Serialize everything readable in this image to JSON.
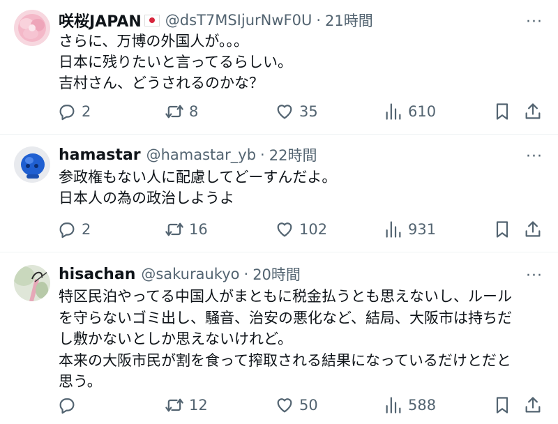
{
  "posts": [
    {
      "name": "咲桜JAPAN",
      "handle": "@dsT7MSIjurNwF0U",
      "separator": "·",
      "time": "21時間",
      "lines": [
        "さらに、万博の外国人が。。。",
        "日本に残りたいと言ってるらしい。",
        "吉村さん、どうされるのかな？"
      ],
      "replies": "2",
      "reposts": "8",
      "likes": "35",
      "views": "610",
      "avatar_icon": "pink-flower-avatar"
    },
    {
      "name": "hamastar",
      "handle": "@hamastar_yb",
      "separator": "·",
      "time": "22時間",
      "lines": [
        "参政権もない人に配慮してどーすんだよ。",
        "日本人の為の政治しようよ"
      ],
      "replies": "2",
      "reposts": "16",
      "likes": "102",
      "views": "931",
      "avatar_icon": "blue-character-avatar"
    },
    {
      "name": "hisachan",
      "handle": "@sakuraukyo",
      "separator": "·",
      "time": "20時間",
      "lines": [
        "特区民泊やってる中国人がまともに税金払うとも思えないし、ルール",
        "を守らないゴミ出し、騒音、治安の悪化など、結局、大阪市は持ちだ",
        "し敷かないとしか思えないけれど。",
        "本来の大阪市民が割を食って搾取される結果になっているだけとだと",
        "思う。"
      ],
      "replies": "",
      "reposts": "12",
      "likes": "50",
      "views": "588",
      "avatar_icon": "flower-photo-avatar"
    }
  ],
  "icons": {
    "reply": "reply-icon",
    "repost": "repost-icon",
    "like": "heart-icon",
    "views": "views-icon",
    "bookmark": "bookmark-icon",
    "share": "share-icon",
    "more": "more-icon"
  },
  "more_label": "···",
  "colors": {
    "text": "#0f1419",
    "muted": "#536471",
    "divider": "#eff3f4"
  }
}
